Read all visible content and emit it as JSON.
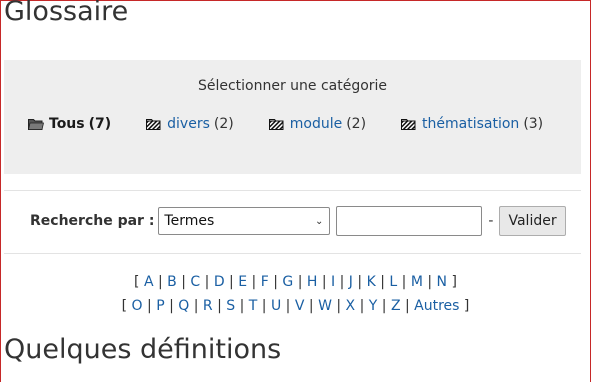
{
  "page": {
    "title": "Glossaire",
    "section_title": "Quelques définitions"
  },
  "categories": {
    "heading": "Sélectionner une catégorie",
    "items": [
      {
        "label": "Tous",
        "count": "(7)",
        "active": true,
        "icon": "folder-open-icon"
      },
      {
        "label": "divers",
        "count": "(2)",
        "active": false,
        "icon": "folder-striped-icon"
      },
      {
        "label": "module",
        "count": "(2)",
        "active": false,
        "icon": "folder-striped-icon"
      },
      {
        "label": "thématisation",
        "count": "(3)",
        "active": false,
        "icon": "folder-striped-icon"
      }
    ]
  },
  "search": {
    "label": "Recherche par :",
    "select_value": "Termes",
    "input_value": "",
    "dash": "-",
    "button_label": "Valider"
  },
  "alphabet": {
    "row1": [
      "A",
      "B",
      "C",
      "D",
      "E",
      "F",
      "G",
      "H",
      "I",
      "J",
      "K",
      "L",
      "M",
      "N"
    ],
    "row2": [
      "O",
      "P",
      "Q",
      "R",
      "S",
      "T",
      "U",
      "V",
      "W",
      "X",
      "Y",
      "Z",
      "Autres"
    ]
  },
  "colors": {
    "link": "#1a5fa3",
    "panel_bg": "#eeeeee",
    "frame_border": "#c62828"
  }
}
